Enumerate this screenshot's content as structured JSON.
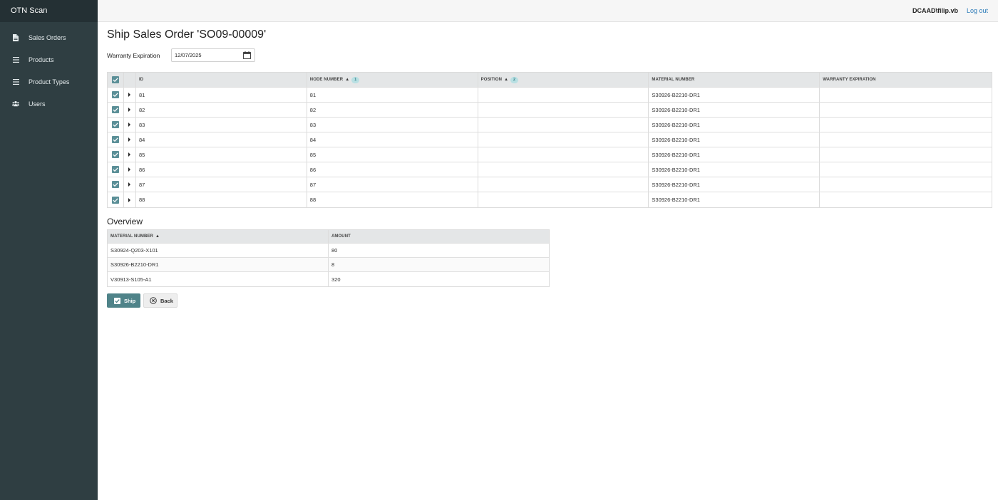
{
  "app": {
    "title": "OTN Scan"
  },
  "sidebar": {
    "items": [
      {
        "label": "Sales Orders",
        "icon": "document-icon"
      },
      {
        "label": "Products",
        "icon": "list-icon"
      },
      {
        "label": "Product Types",
        "icon": "list-icon"
      },
      {
        "label": "Users",
        "icon": "users-icon"
      }
    ]
  },
  "topbar": {
    "user": "DCAAD\\filip.vb",
    "logout": "Log out"
  },
  "page": {
    "title": "Ship Sales Order 'SO09-00009'",
    "warranty_label": "Warranty Expiration",
    "warranty_value": "12/07/2025"
  },
  "grid": {
    "headers": {
      "id": "ID",
      "node_number": "NODE NUMBER",
      "node_sort_index": "1",
      "position": "POSITION",
      "position_sort_index": "2",
      "material_number": "MATERIAL NUMBER",
      "warranty_expiration": "WARRANTY EXPIRATION"
    },
    "sort_indicator": "▲",
    "rows": [
      {
        "id": "81",
        "node": "81",
        "position": "",
        "material": "S30926-B2210-DR1",
        "warranty": ""
      },
      {
        "id": "82",
        "node": "82",
        "position": "",
        "material": "S30926-B2210-DR1",
        "warranty": ""
      },
      {
        "id": "83",
        "node": "83",
        "position": "",
        "material": "S30926-B2210-DR1",
        "warranty": ""
      },
      {
        "id": "84",
        "node": "84",
        "position": "",
        "material": "S30926-B2210-DR1",
        "warranty": ""
      },
      {
        "id": "85",
        "node": "85",
        "position": "",
        "material": "S30926-B2210-DR1",
        "warranty": ""
      },
      {
        "id": "86",
        "node": "86",
        "position": "",
        "material": "S30926-B2210-DR1",
        "warranty": ""
      },
      {
        "id": "87",
        "node": "87",
        "position": "",
        "material": "S30926-B2210-DR1",
        "warranty": ""
      },
      {
        "id": "88",
        "node": "88",
        "position": "",
        "material": "S30926-B2210-DR1",
        "warranty": ""
      }
    ]
  },
  "overview": {
    "title": "Overview",
    "headers": {
      "material_number": "MATERIAL NUMBER",
      "amount": "AMOUNT"
    },
    "rows": [
      {
        "material": "S30924-Q203-X101",
        "amount": "80"
      },
      {
        "material": "S30926-B2210-DR1",
        "amount": "8"
      },
      {
        "material": "V30913-S105-A1",
        "amount": "320"
      }
    ]
  },
  "actions": {
    "ship": "Ship",
    "back": "Back"
  },
  "colors": {
    "sidebar": "#2f3e42",
    "accent": "#4f8389",
    "link": "#2a7ab8"
  }
}
